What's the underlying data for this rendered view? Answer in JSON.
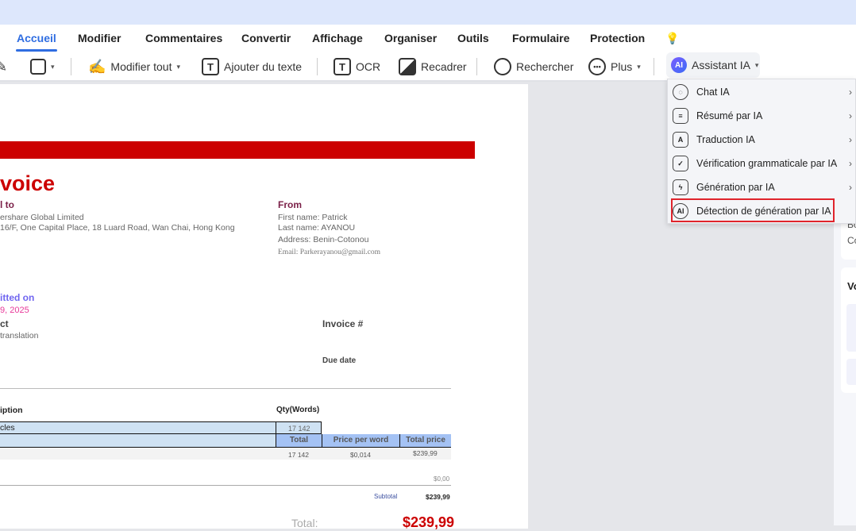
{
  "tabs": [
    "Accueil",
    "Modifier",
    "Commentaires",
    "Convertir",
    "Affichage",
    "Organiser",
    "Outils",
    "Formulaire",
    "Protection"
  ],
  "active_tab": "Accueil",
  "toolbar": {
    "edit_all": "Modifier tout",
    "add_text": "Ajouter du texte",
    "ocr": "OCR",
    "crop": "Recadrer",
    "search": "Rechercher",
    "more": "Plus",
    "ai_assistant": "Assistant IA",
    "ai_badge": "AI"
  },
  "ai_menu": {
    "items": [
      {
        "label": "Chat IA",
        "icon": "chat-bot-icon",
        "submenu": true
      },
      {
        "label": "Résumé par IA",
        "icon": "summary-icon",
        "submenu": true
      },
      {
        "label": "Traduction IA",
        "icon": "translate-icon",
        "submenu": true
      },
      {
        "label": "Vérification grammaticale par IA",
        "icon": "grammar-check-icon",
        "submenu": true
      },
      {
        "label": "Génération par IA",
        "icon": "lightning-icon",
        "submenu": true
      },
      {
        "label": "Détection de génération par IA",
        "icon": "ai-detect-icon",
        "submenu": false,
        "highlighted": true
      }
    ],
    "highlight_color": "#e0242c"
  },
  "right_panel": {
    "line1": "Bo",
    "line2": "Co",
    "heading": "Vo"
  },
  "invoice": {
    "title": "voice",
    "bill_to_label": "l to",
    "bill_to_name": "ershare Global Limited",
    "bill_to_address": " 16/F, One Capital Place, 18 Luard Road, Wan Chai, Hong Kong",
    "from_label": "From",
    "first_name": "First name: Patrick",
    "last_name": "Last name: AYANOU",
    "address": "Address: Benin-Cotonou",
    "email": "Email: Parkerayanou@gmail.com",
    "submitted_label": "itted on",
    "submitted_date": "9, 2025",
    "project_label": "ct",
    "project_value": " translation",
    "invoice_no_label": "Invoice #",
    "due_date_label": "Due date",
    "description_header": "iption",
    "qty_header": "Qty(Words)",
    "row_desc": "cles",
    "row_qty": "17 142",
    "total_header": "Total",
    "ppw_header": "Price per word",
    "tp_header": "Total price",
    "total_qty": "17 142",
    "ppw": "$0,014",
    "total_price": "$239,99",
    "zero": "$0,00",
    "subtotal_label": "Subtotal",
    "subtotal": "$239,99",
    "grand_total_label": "Total:",
    "grand_total": "$239,99",
    "brand_color": "#cc0000"
  }
}
